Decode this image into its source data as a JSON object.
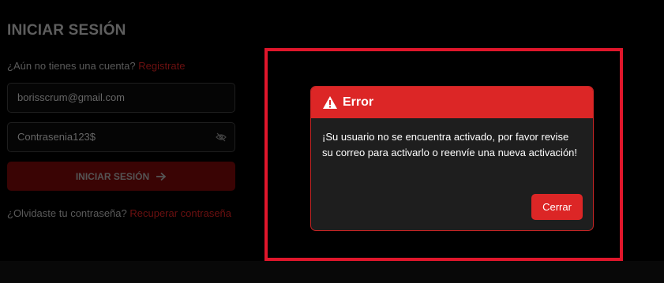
{
  "login": {
    "title": "INICIAR SESIÓN",
    "signup_prompt": "¿Aún no tienes una cuenta?",
    "signup_link": "Registrate",
    "email_value": "borisscrum@gmail.com",
    "password_value": "Contrasenia123$",
    "submit_label": "INICIAR SESIÓN",
    "forgot_prompt": "¿Olvidaste tu contraseña?",
    "forgot_link": "Recuperar contraseña"
  },
  "modal": {
    "title": "Error",
    "message": "¡Su usuario no se encuentra activado, por favor revise su correo para activarlo o reenvíe una nueva activación!",
    "close_label": "Cerrar"
  },
  "icons": {
    "warning": "warning-icon",
    "eye_off": "eye-off-icon",
    "arrow_right": "arrow-right-icon"
  },
  "colors": {
    "accent": "#dc2626",
    "highlight": "#e0162b",
    "modal_bg": "#1e1e1e",
    "page_bg": "#000000"
  }
}
